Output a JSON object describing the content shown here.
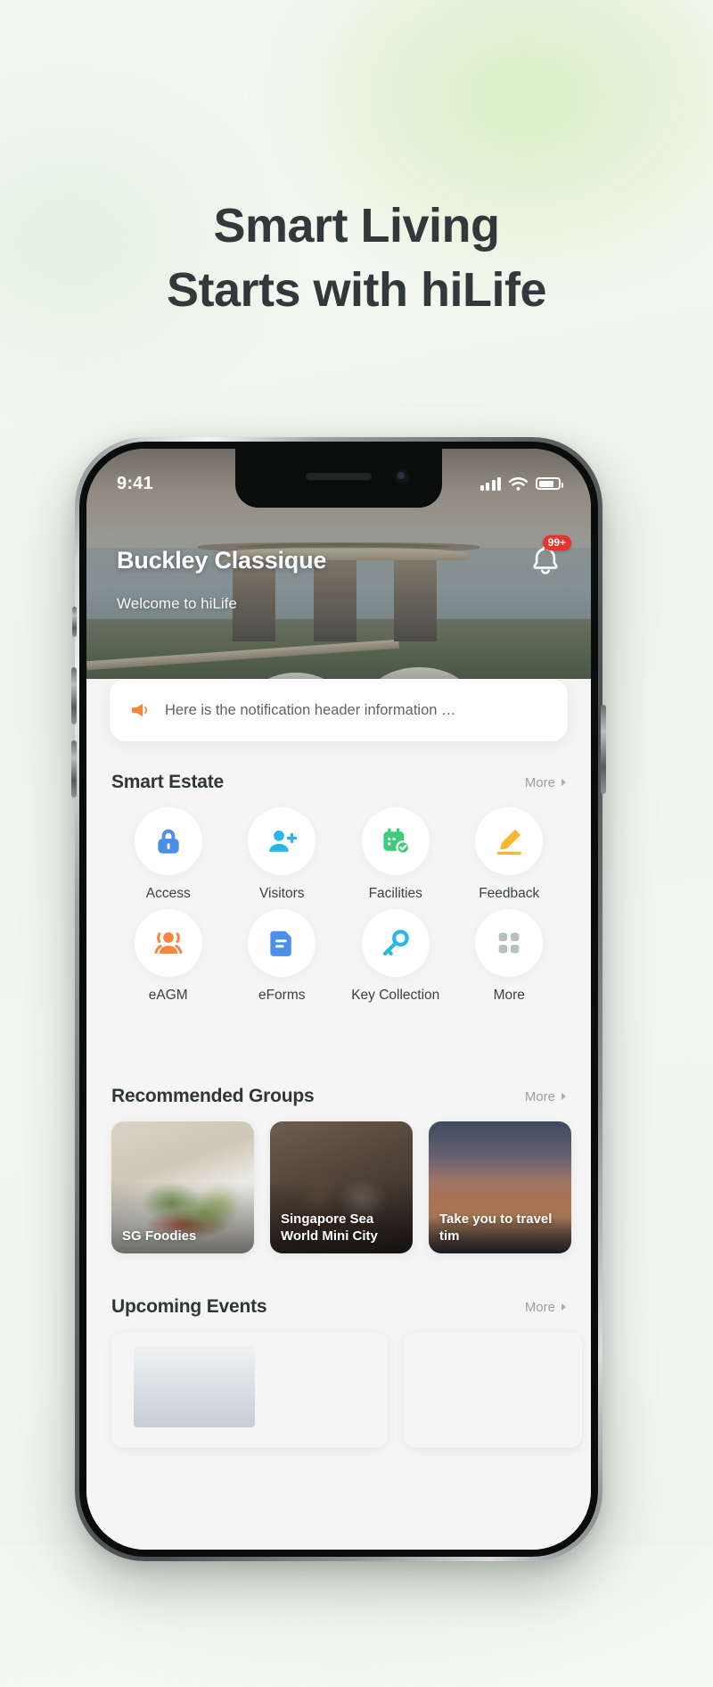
{
  "marketing": {
    "headline_line1": "Smart Living",
    "headline_line2": "Starts with hiLife"
  },
  "phone": {
    "status_bar": {
      "time": "9:41",
      "signal_icon": "cellular-signal-icon",
      "wifi_icon": "wifi-icon",
      "battery_icon": "battery-icon"
    },
    "hero": {
      "title": "Buckley Classique",
      "subtitle": "Welcome to hiLife",
      "bell_icon": "bell-icon",
      "bell_badge": "99+",
      "carousel_dots": 3,
      "carousel_active_index": 0
    },
    "notification": {
      "icon": "megaphone-icon",
      "text": "Here is the notification header information …"
    },
    "smart_estate": {
      "title": "Smart Estate",
      "more_label": "More",
      "tiles": [
        {
          "label": "Access",
          "icon": "lock-icon",
          "color": "#4a90e8"
        },
        {
          "label": "Visitors",
          "icon": "person-add-icon",
          "color": "#29b6e8"
        },
        {
          "label": "Facilities",
          "icon": "calendar-check-icon",
          "color": "#3dcc79"
        },
        {
          "label": "Feedback",
          "icon": "pencil-icon",
          "color": "#f5b82e"
        },
        {
          "label": "eAGM",
          "icon": "people-group-icon",
          "color": "#f5853f"
        },
        {
          "label": "eForms",
          "icon": "document-icon",
          "color": "#4a90e8"
        },
        {
          "label": "Key Collection",
          "icon": "key-icon",
          "color": "#29b6e8"
        },
        {
          "label": "More",
          "icon": "grid-dots-icon",
          "color": "#b6c0bd"
        }
      ]
    },
    "recommended_groups": {
      "title": "Recommended Groups",
      "more_label": "More",
      "cards": [
        {
          "title": "SG Foodies",
          "art": "art-salad"
        },
        {
          "title": "Singapore Sea World Mini City",
          "art": "art-seal"
        },
        {
          "title": "Take you to travel tim",
          "art": "art-sunset"
        }
      ]
    },
    "upcoming_events": {
      "title": "Upcoming Events",
      "more_label": "More",
      "cards": [
        {
          "art": "art-room"
        },
        {
          "art": "art-beach"
        }
      ]
    }
  }
}
